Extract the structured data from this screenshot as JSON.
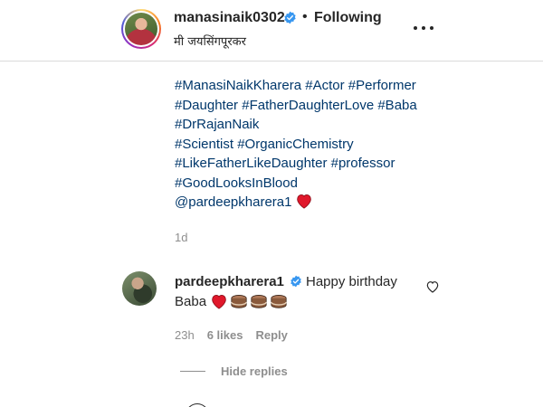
{
  "post_header": {
    "username": "manasinaik0302",
    "separator": "•",
    "follow_status": "Following",
    "subtitle": "मी जयसिंगपूरकर"
  },
  "caption": {
    "lines": [
      [
        "#ManasiNaikKharera",
        "#Actor",
        "#Performer"
      ],
      [
        "#Daughter",
        "#FatherDaughterLove",
        "#Baba"
      ],
      [
        "#DrRajanNaik"
      ],
      [
        "#Scientist",
        "#OrganicChemistry"
      ],
      [
        "#LikeFatherLikeDaughter",
        "#professor"
      ],
      [
        "#GoodLooksInBlood"
      ]
    ],
    "mention": "@pardeepkharera1",
    "time": "1d"
  },
  "comment": {
    "username": "pardeepkharera1",
    "text_line1": "Happy birthday",
    "text_line2": "Baba",
    "time": "23h",
    "likes": "6 likes",
    "reply": "Reply",
    "hide_replies": "Hide replies"
  },
  "colors": {
    "hashtag": "#00376b",
    "verified": "#3897f0",
    "heart": "#ed4956",
    "secondary_text": "#8e8e8e"
  },
  "icons": {
    "verified": "verified-badge-icon",
    "more": "more-options-icon",
    "heart": "red-heart-emoji",
    "cake": "cake-emoji",
    "like": "heart-outline-icon"
  }
}
